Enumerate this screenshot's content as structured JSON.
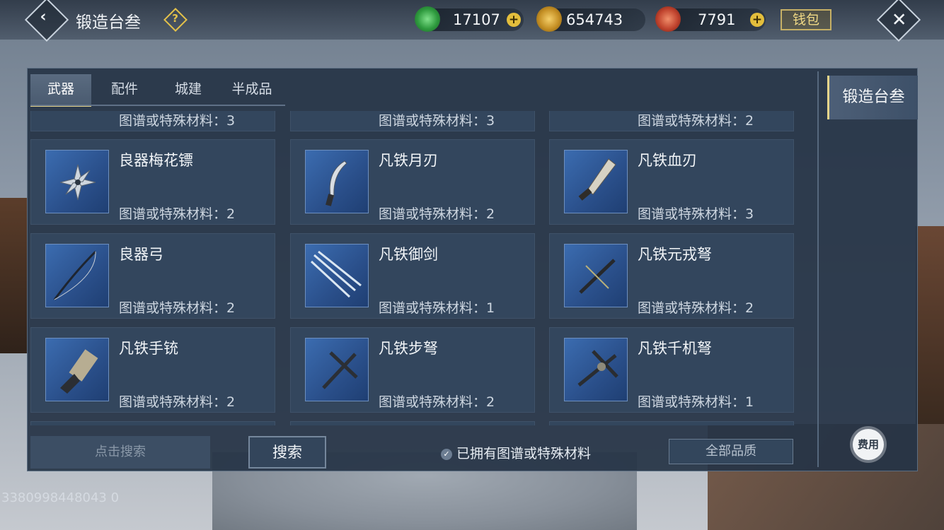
{
  "header": {
    "title": "锻造台叁",
    "back_icon": "‹",
    "help_icon": "?",
    "close_icon": "✕"
  },
  "currencies": [
    {
      "name": "jade",
      "value": "17107",
      "color": "#3aa84a"
    },
    {
      "name": "gold-coin",
      "value": "654743",
      "color": "#c9962b"
    },
    {
      "name": "red-token",
      "value": "7791",
      "color": "#c0432e"
    }
  ],
  "wallet_label": "钱包",
  "tabs": [
    "武器",
    "配件",
    "城建",
    "半成品"
  ],
  "partial_row": [
    {
      "req": "图谱或特殊材料：3"
    },
    {
      "req": "图谱或特殊材料：3"
    },
    {
      "req": "图谱或特殊材料：2"
    }
  ],
  "items": [
    {
      "name": "良器梅花镖",
      "req": "图谱或特殊材料：2",
      "icon": "shuriken-icon"
    },
    {
      "name": "凡铁月刃",
      "req": "图谱或特殊材料：2",
      "icon": "crescent-blade-icon"
    },
    {
      "name": "凡铁血刃",
      "req": "图谱或特殊材料：3",
      "icon": "blood-blade-icon"
    },
    {
      "name": "良器弓",
      "req": "图谱或特殊材料：2",
      "icon": "bow-icon"
    },
    {
      "name": "凡铁御剑",
      "req": "图谱或特殊材料：1",
      "icon": "flying-swords-icon"
    },
    {
      "name": "凡铁元戎弩",
      "req": "图谱或特殊材料：2",
      "icon": "crossbow-icon"
    },
    {
      "name": "凡铁手铳",
      "req": "图谱或特殊材料：2",
      "icon": "hand-cannon-icon"
    },
    {
      "name": "凡铁步弩",
      "req": "图谱或特殊材料：2",
      "icon": "foot-crossbow-icon"
    },
    {
      "name": "凡铁千机弩",
      "req": "图谱或特殊材料：1",
      "icon": "mechanism-crossbow-icon"
    }
  ],
  "footer": {
    "search_placeholder": "点击搜索",
    "search_button": "搜索",
    "owned_filter": "已拥有图谱或特殊材料",
    "quality_filter": "全部品质"
  },
  "side": {
    "station_tab": "锻造台叁",
    "fee_button": "费用"
  },
  "uid": "3380998448043 0"
}
